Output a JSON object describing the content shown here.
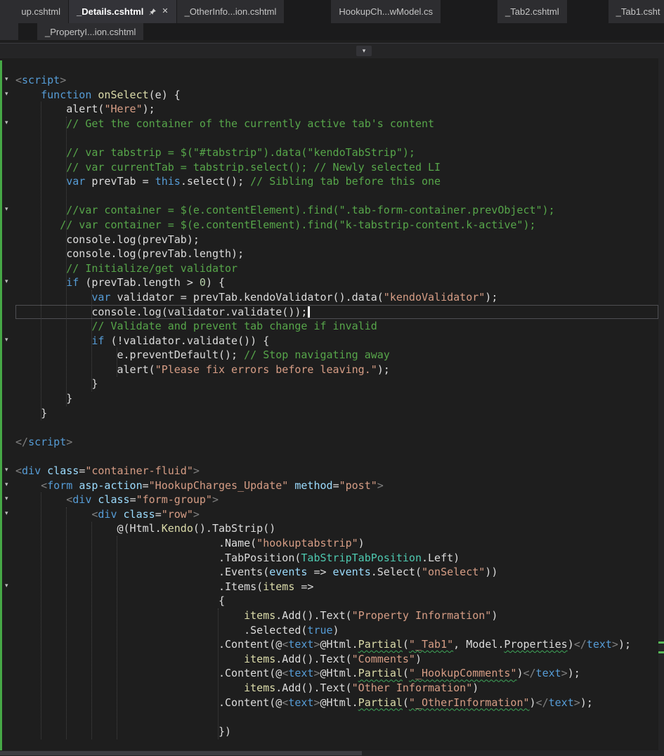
{
  "tab_rows": [
    {
      "name": "row1",
      "tabs": [
        {
          "label": "up.cshtml",
          "style": "clipped-left"
        },
        {
          "label": "_Details.cshtml",
          "active": true,
          "icons": {
            "pin": true,
            "close": true
          }
        },
        {
          "label": "_OtherInfo...ion.cshtml"
        },
        {
          "label": "HookupCh...wModel.cs",
          "gap": 66
        },
        {
          "label": "_Tab2.cshtml",
          "gap": 80
        },
        {
          "label": "_Tab1.csht",
          "gap": 58,
          "style": "clipped-right"
        }
      ]
    },
    {
      "name": "row2",
      "tabs": [
        {
          "label": "",
          "style": "stub"
        },
        {
          "label": "_PropertyI...ion.cshtml",
          "gap": 26,
          "row2": true
        }
      ]
    }
  ],
  "header": {
    "dropdown_icon": "chevron-down",
    "dropdown_glyph": "▾"
  },
  "editor": {
    "colors": {
      "background": "#1e1e1e",
      "change_tracking_green": "#46a846",
      "current_line_border": "#4e4e52",
      "keyword": "#569cd6",
      "string": "#d69d85",
      "comment": "#57a64a",
      "html_delimiter": "#808080",
      "attribute": "#9cdcfe",
      "method_yellow": "#dcdcaa",
      "type_teal": "#4ec9b0",
      "number": "#b5cea8",
      "plain": "#dcdcdc"
    },
    "caret_line_index": 16,
    "fold_line_indices": [
      0,
      1,
      3,
      9,
      14,
      18,
      27,
      28,
      29,
      30,
      35
    ],
    "scrollbar_marks_y": [
      830,
      844
    ],
    "lines": [
      {
        "tokens": [
          [
            "<",
            "d"
          ],
          [
            "script",
            "k"
          ],
          [
            ">",
            "d"
          ]
        ]
      },
      {
        "tokens": [
          [
            "    ",
            "p"
          ],
          [
            "function",
            "k"
          ],
          [
            " ",
            "p"
          ],
          [
            "onSelect",
            "y"
          ],
          [
            "(e) {",
            "p"
          ]
        ]
      },
      {
        "tokens": [
          [
            "        alert(",
            "p"
          ],
          [
            "\"Here\"",
            "s"
          ],
          [
            ");",
            "p"
          ]
        ]
      },
      {
        "tokens": [
          [
            "        ",
            "p"
          ],
          [
            "// Get the container of the currently active tab's content",
            "c"
          ]
        ]
      },
      {
        "tokens": []
      },
      {
        "tokens": [
          [
            "        ",
            "p"
          ],
          [
            "// var tabstrip = $(\"#tabstrip\").data(\"kendoTabStrip\");",
            "c"
          ]
        ]
      },
      {
        "tokens": [
          [
            "        ",
            "p"
          ],
          [
            "// var currentTab = tabstrip.select(); // Newly selected LI",
            "c"
          ]
        ]
      },
      {
        "tokens": [
          [
            "        ",
            "p"
          ],
          [
            "var",
            "k"
          ],
          [
            " prevTab = ",
            "p"
          ],
          [
            "this",
            "k"
          ],
          [
            ".select(); ",
            "p"
          ],
          [
            "// Sibling tab before this one",
            "c"
          ]
        ]
      },
      {
        "tokens": []
      },
      {
        "tokens": [
          [
            "        ",
            "p"
          ],
          [
            "//var container = $(e.contentElement).find(\".tab-form-container.prevObject\");",
            "c"
          ]
        ]
      },
      {
        "tokens": [
          [
            "       ",
            "p"
          ],
          [
            "// var container = $(e.contentElement).find(\"k-tabstrip-content.k-active\");",
            "c"
          ]
        ]
      },
      {
        "tokens": [
          [
            "        console.log(prevTab);",
            "p"
          ]
        ]
      },
      {
        "tokens": [
          [
            "        console.log(prevTab.length);",
            "p"
          ]
        ]
      },
      {
        "tokens": [
          [
            "        ",
            "p"
          ],
          [
            "// Initialize/get validator",
            "c"
          ]
        ]
      },
      {
        "tokens": [
          [
            "        ",
            "p"
          ],
          [
            "if",
            "k"
          ],
          [
            " (prevTab.length > ",
            "p"
          ],
          [
            "0",
            "n"
          ],
          [
            ") {",
            "p"
          ]
        ]
      },
      {
        "tokens": [
          [
            "            ",
            "p"
          ],
          [
            "var",
            "k"
          ],
          [
            " validator = prevTab.kendoValidator().data(",
            "p"
          ],
          [
            "\"kendoValidator\"",
            "s"
          ],
          [
            ");",
            "p"
          ]
        ]
      },
      {
        "tokens": [
          [
            "            console.log(validator.validate());",
            "p"
          ]
        ]
      },
      {
        "tokens": [
          [
            "            ",
            "p"
          ],
          [
            "// Validate and prevent tab change if invalid",
            "c"
          ]
        ]
      },
      {
        "tokens": [
          [
            "            ",
            "p"
          ],
          [
            "if",
            "k"
          ],
          [
            " (!validator.validate()) {",
            "p"
          ]
        ]
      },
      {
        "tokens": [
          [
            "                e.preventDefault(); ",
            "p"
          ],
          [
            "// Stop navigating away",
            "c"
          ]
        ]
      },
      {
        "tokens": [
          [
            "                alert(",
            "p"
          ],
          [
            "\"Please fix errors before leaving.\"",
            "s"
          ],
          [
            ");",
            "p"
          ]
        ]
      },
      {
        "tokens": [
          [
            "            }",
            "p"
          ]
        ]
      },
      {
        "tokens": [
          [
            "        }",
            "p"
          ]
        ]
      },
      {
        "tokens": [
          [
            "    }",
            "p"
          ]
        ]
      },
      {
        "tokens": []
      },
      {
        "tokens": [
          [
            "</",
            "d"
          ],
          [
            "script",
            "k"
          ],
          [
            ">",
            "d"
          ]
        ]
      },
      {
        "tokens": []
      },
      {
        "tokens": [
          [
            "<",
            "d"
          ],
          [
            "div",
            "k"
          ],
          [
            " ",
            "p"
          ],
          [
            "class",
            "a"
          ],
          [
            "=",
            "p"
          ],
          [
            "\"container-fluid\"",
            "s"
          ],
          [
            ">",
            "d"
          ]
        ]
      },
      {
        "tokens": [
          [
            "    ",
            "p"
          ],
          [
            "<",
            "d"
          ],
          [
            "form",
            "k"
          ],
          [
            " ",
            "p"
          ],
          [
            "asp-action",
            "a"
          ],
          [
            "=",
            "p"
          ],
          [
            "\"HookupCharges_Update\"",
            "s"
          ],
          [
            " ",
            "p"
          ],
          [
            "method",
            "a"
          ],
          [
            "=",
            "p"
          ],
          [
            "\"post\"",
            "s"
          ],
          [
            ">",
            "d"
          ]
        ]
      },
      {
        "tokens": [
          [
            "        ",
            "p"
          ],
          [
            "<",
            "d"
          ],
          [
            "div",
            "k"
          ],
          [
            " ",
            "p"
          ],
          [
            "class",
            "a"
          ],
          [
            "=",
            "p"
          ],
          [
            "\"form-group\"",
            "s"
          ],
          [
            ">",
            "d"
          ]
        ]
      },
      {
        "tokens": [
          [
            "            ",
            "p"
          ],
          [
            "<",
            "d"
          ],
          [
            "div",
            "k"
          ],
          [
            " ",
            "p"
          ],
          [
            "class",
            "a"
          ],
          [
            "=",
            "p"
          ],
          [
            "\"row\"",
            "s"
          ],
          [
            ">",
            "d"
          ]
        ]
      },
      {
        "tokens": [
          [
            "                @(Html.",
            "p"
          ],
          [
            "Kendo",
            "y"
          ],
          [
            "().TabStrip()",
            "p"
          ]
        ]
      },
      {
        "tokens": [
          [
            "                                .Name(",
            "p"
          ],
          [
            "\"hookuptabstrip\"",
            "s"
          ],
          [
            ")",
            "p"
          ]
        ]
      },
      {
        "tokens": [
          [
            "                                .TabPosition(",
            "p"
          ],
          [
            "TabStripTabPosition",
            "t"
          ],
          [
            ".Left)",
            "p"
          ]
        ]
      },
      {
        "tokens": [
          [
            "                                .Events(",
            "p"
          ],
          [
            "events",
            "a"
          ],
          [
            " => ",
            "p"
          ],
          [
            "events",
            "a"
          ],
          [
            ".Select(",
            "p"
          ],
          [
            "\"onSelect\"",
            "s"
          ],
          [
            "))",
            "p"
          ]
        ]
      },
      {
        "tokens": [
          [
            "                                .Items(",
            "p"
          ],
          [
            "items",
            "y"
          ],
          [
            " =>",
            "p"
          ]
        ]
      },
      {
        "tokens": [
          [
            "                                {",
            "p"
          ]
        ]
      },
      {
        "tokens": [
          [
            "                                    ",
            "p"
          ],
          [
            "items",
            "y"
          ],
          [
            ".Add().Text(",
            "p"
          ],
          [
            "\"Property Information\"",
            "s"
          ],
          [
            ")",
            "p"
          ]
        ]
      },
      {
        "tokens": [
          [
            "                                    .Selected(",
            "p"
          ],
          [
            "true",
            "k"
          ],
          [
            ")",
            "p"
          ]
        ]
      },
      {
        "tokens": [
          [
            "                                .Content(@",
            "p"
          ],
          [
            "<",
            "d"
          ],
          [
            "text",
            "k"
          ],
          [
            ">",
            "d"
          ],
          [
            "@Html.",
            "p"
          ],
          [
            "Partial",
            "y sq"
          ],
          [
            "(",
            "p"
          ],
          [
            "\"_Tab1\"",
            "s sq"
          ],
          [
            ", Model.",
            "p"
          ],
          [
            "Properties",
            "p sq"
          ],
          [
            ")",
            "p"
          ],
          [
            "</",
            "d"
          ],
          [
            "text",
            "k"
          ],
          [
            ">",
            "d"
          ],
          [
            ");",
            "p"
          ]
        ]
      },
      {
        "tokens": [
          [
            "                                    ",
            "p"
          ],
          [
            "items",
            "y"
          ],
          [
            ".Add().Text(",
            "p"
          ],
          [
            "\"Comments\"",
            "s"
          ],
          [
            ")",
            "p"
          ]
        ]
      },
      {
        "tokens": [
          [
            "                                .Content(@",
            "p"
          ],
          [
            "<",
            "d"
          ],
          [
            "text",
            "k"
          ],
          [
            ">",
            "d"
          ],
          [
            "@Html.",
            "p"
          ],
          [
            "Partial",
            "y sq"
          ],
          [
            "(",
            "p"
          ],
          [
            "\"_HookupComments\"",
            "s sq"
          ],
          [
            ")",
            "p"
          ],
          [
            "</",
            "d"
          ],
          [
            "text",
            "k"
          ],
          [
            ">",
            "d"
          ],
          [
            ");",
            "p"
          ]
        ]
      },
      {
        "tokens": [
          [
            "                                    ",
            "p"
          ],
          [
            "items",
            "y"
          ],
          [
            ".Add().Text(",
            "p"
          ],
          [
            "\"Other Information\"",
            "s"
          ],
          [
            ")",
            "p"
          ]
        ]
      },
      {
        "tokens": [
          [
            "                                .Content(@",
            "p"
          ],
          [
            "<",
            "d"
          ],
          [
            "text",
            "k"
          ],
          [
            ">",
            "d"
          ],
          [
            "@Html.",
            "p"
          ],
          [
            "Partial",
            "y sq"
          ],
          [
            "(",
            "p"
          ],
          [
            "\"_OtherInformation\"",
            "s sq"
          ],
          [
            ")",
            "p"
          ],
          [
            "</",
            "d"
          ],
          [
            "text",
            "k"
          ],
          [
            ">",
            "d"
          ],
          [
            ");",
            "p"
          ]
        ]
      },
      {
        "tokens": []
      },
      {
        "tokens": [
          [
            "                                })",
            "p"
          ]
        ]
      }
    ]
  }
}
